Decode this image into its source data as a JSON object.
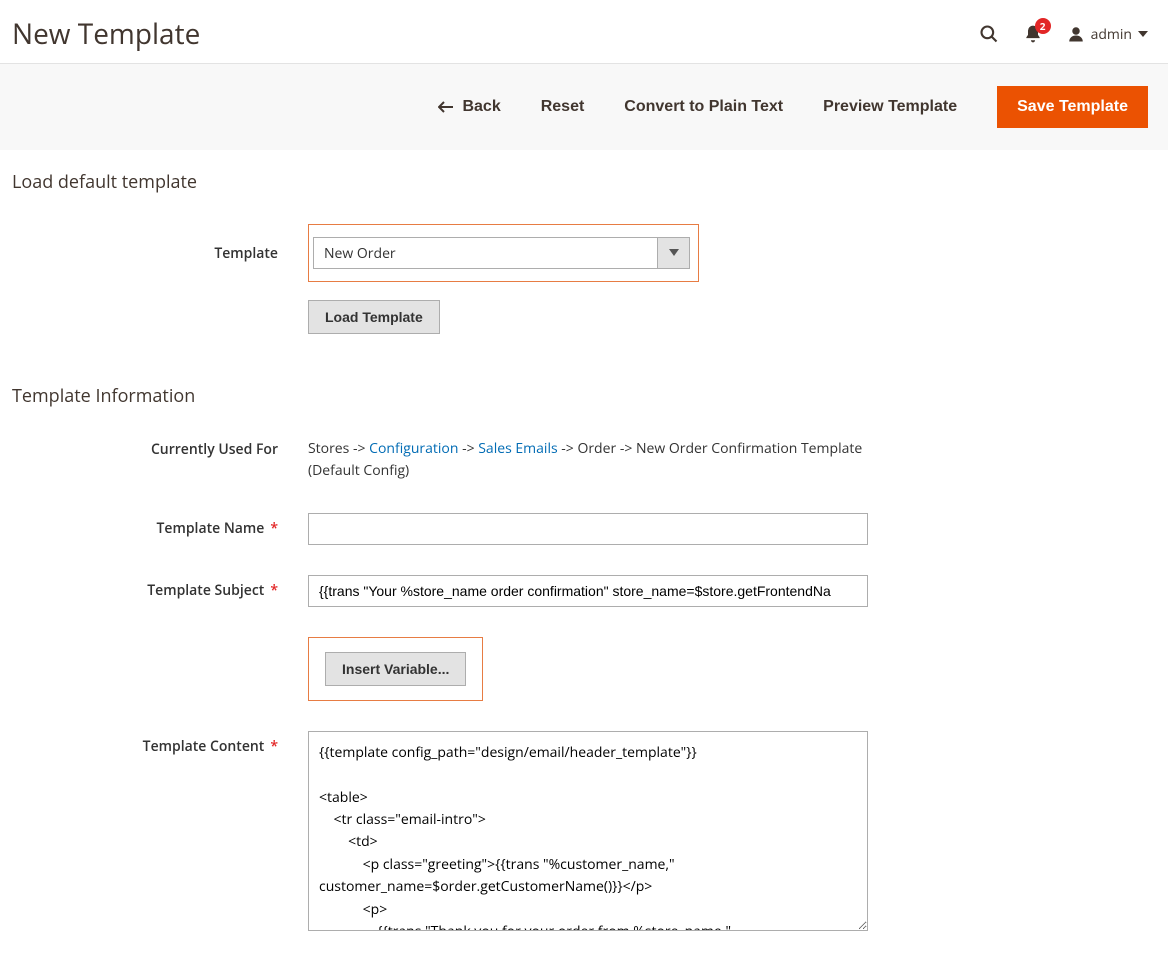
{
  "header": {
    "title": "New Template",
    "notification_count": "2",
    "username": "admin"
  },
  "actions": {
    "back": "Back",
    "reset": "Reset",
    "convert": "Convert to Plain Text",
    "preview": "Preview Template",
    "save": "Save Template"
  },
  "sections": {
    "load_default": {
      "title": "Load default template",
      "template_label": "Template",
      "template_value": "New Order",
      "load_button": "Load Template"
    },
    "template_info": {
      "title": "Template Information",
      "used_for_label": "Currently Used For",
      "used_for": {
        "prefix": "Stores -> ",
        "link1": "Configuration",
        "mid1": " -> ",
        "link2": "Sales Emails",
        "suffix": " -> Order -> New Order Confirmation Template  (Default Config)"
      },
      "name_label": "Template Name",
      "name_value": "",
      "subject_label": "Template Subject",
      "subject_value": "{{trans \"Your %store_name order confirmation\" store_name=$store.getFrontendNa",
      "insert_variable": "Insert Variable...",
      "content_label": "Template Content",
      "content_value": "{{template config_path=\"design/email/header_template\"}}\n\n<table>\n    <tr class=\"email-intro\">\n        <td>\n            <p class=\"greeting\">{{trans \"%customer_name,\" customer_name=$order.getCustomerName()}}</p>\n            <p>\n                {{trans \"Thank you for your order from %store_name.\" store_name=$store.getFrontendName()}}\n                {{trans \"Once your package ships we will send you a tracking number.\"}}"
    }
  }
}
